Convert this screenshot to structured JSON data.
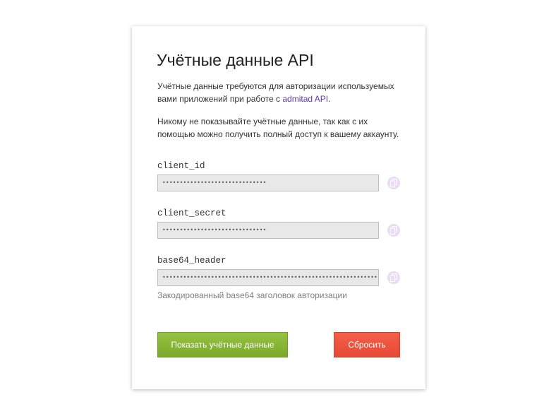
{
  "credentials": {
    "title": "Учётные данные API",
    "intro_text": "Учётные данные требуются для авторизации используемых вами приложений при работе с ",
    "intro_link": "admitad API",
    "intro_end": ".",
    "warning_text": "Никому не показывайте учётные данные, так как с их помощью можно получить полный доступ к вашему аккаунту.",
    "fields": [
      {
        "label": "client_id",
        "value": "••••••••••••••••••••••••••••••"
      },
      {
        "label": "client_secret",
        "value": "••••••••••••••••••••••••••••••"
      },
      {
        "label": "base64_header",
        "value": "••••••••••••••••••••••••••••••••••••••••••••••••••••••••••••••••"
      }
    ],
    "base64_hint": "Закодированный base64 заголовок авторизации",
    "show_button": "Показать учётные данные",
    "reset_button": "Сбросить"
  },
  "colors": {
    "link": "#5b3aa5",
    "show_button": "#8bb937",
    "reset_button": "#ee533e",
    "copy_icon_bg": "#eadcf2"
  },
  "icons": {
    "copy": "copy-icon"
  }
}
